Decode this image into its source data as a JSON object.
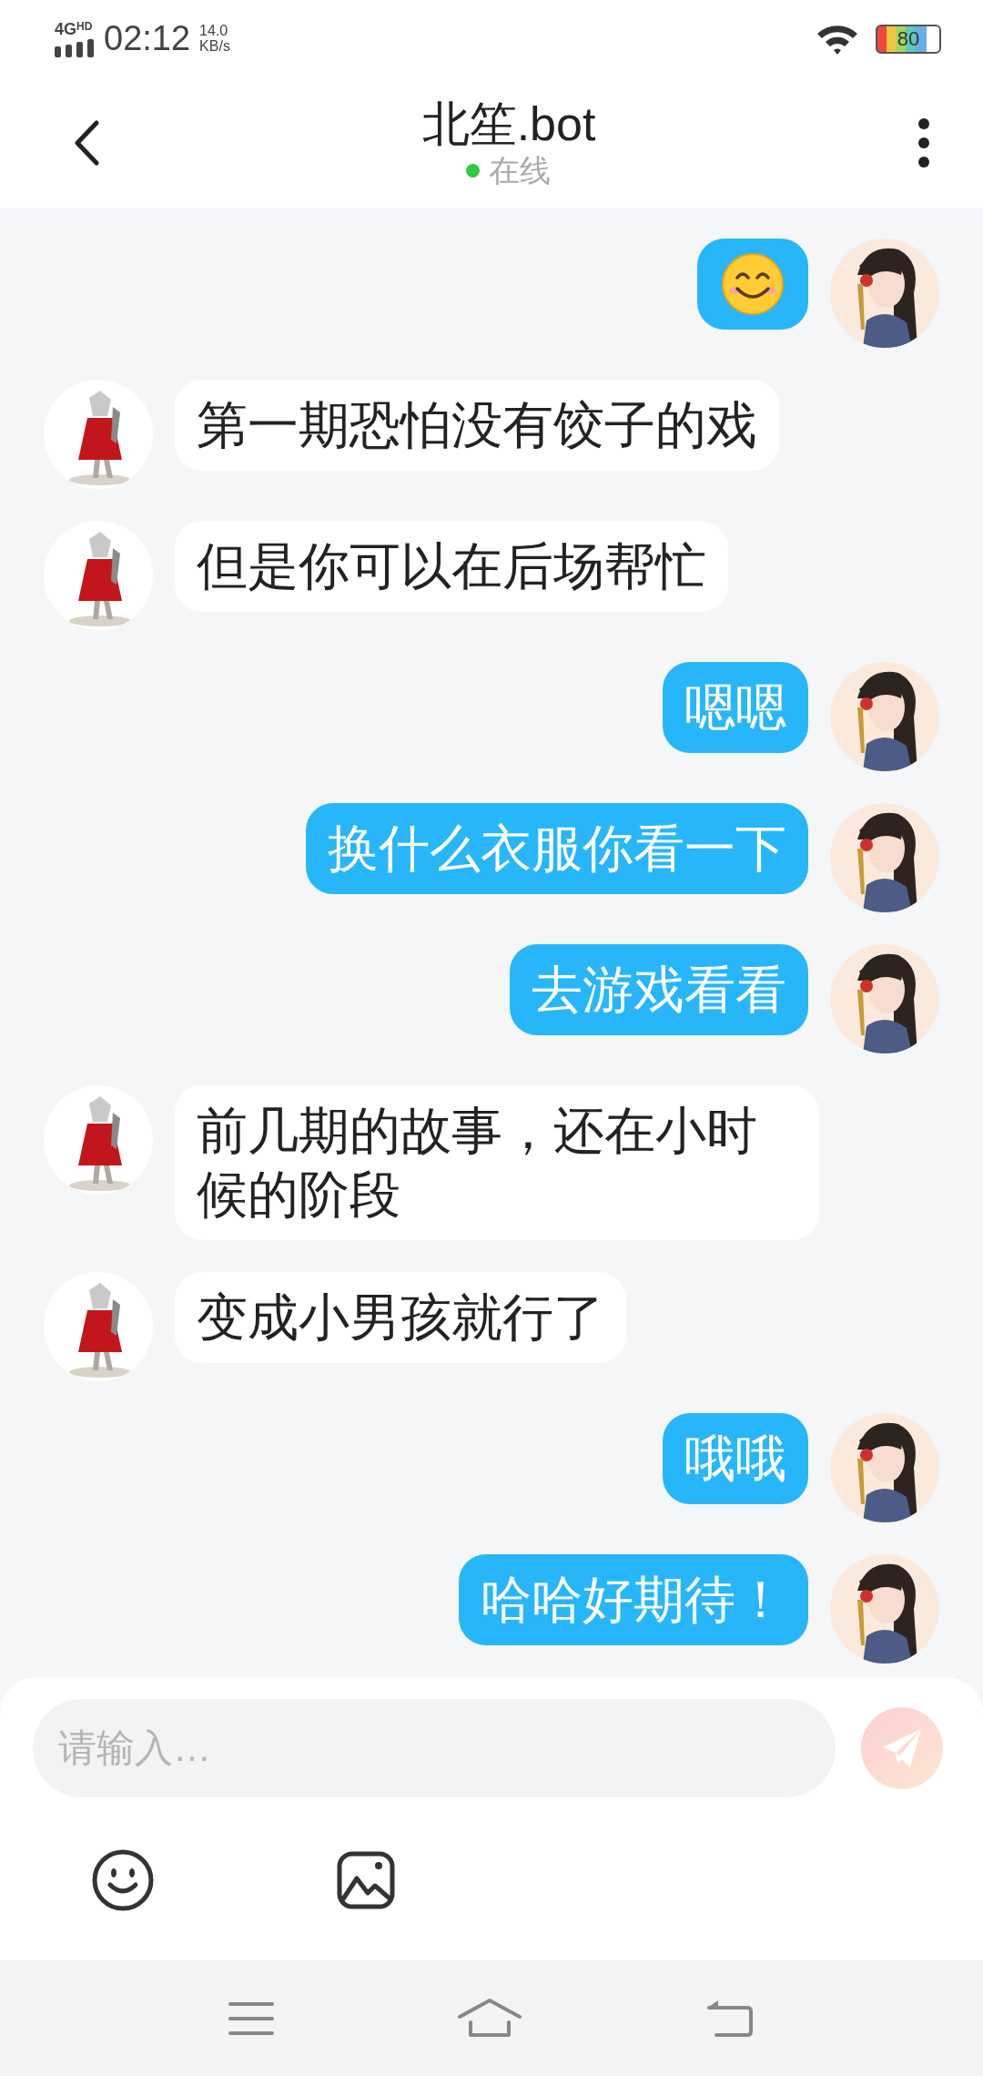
{
  "status_bar": {
    "network": "4G",
    "network_badge": "HD",
    "time": "02:12",
    "speed": "14.0",
    "speed_unit": "KB/s",
    "battery": "80"
  },
  "header": {
    "title": "北笙.bot",
    "online": true,
    "status": "在线"
  },
  "messages": [
    {
      "outgoing": true,
      "kind": "emoji"
    },
    {
      "outgoing": false,
      "kind": "text",
      "text": "第一期恐怕没有饺子的戏"
    },
    {
      "outgoing": false,
      "kind": "text",
      "text": "但是你可以在后场帮忙"
    },
    {
      "outgoing": true,
      "kind": "text",
      "text": "嗯嗯"
    },
    {
      "outgoing": true,
      "kind": "text",
      "text": "换什么衣服你看一下"
    },
    {
      "outgoing": true,
      "kind": "text",
      "text": "去游戏看看"
    },
    {
      "outgoing": false,
      "kind": "text",
      "text": "前几期的故事，还在小时候的阶段"
    },
    {
      "outgoing": false,
      "kind": "text",
      "text": "变成小男孩就行了"
    },
    {
      "outgoing": true,
      "kind": "text",
      "text": "哦哦"
    },
    {
      "outgoing": true,
      "kind": "text",
      "text": "哈哈好期待！"
    }
  ],
  "composer": {
    "placeholder": "请输入…",
    "send_disabled": true
  }
}
